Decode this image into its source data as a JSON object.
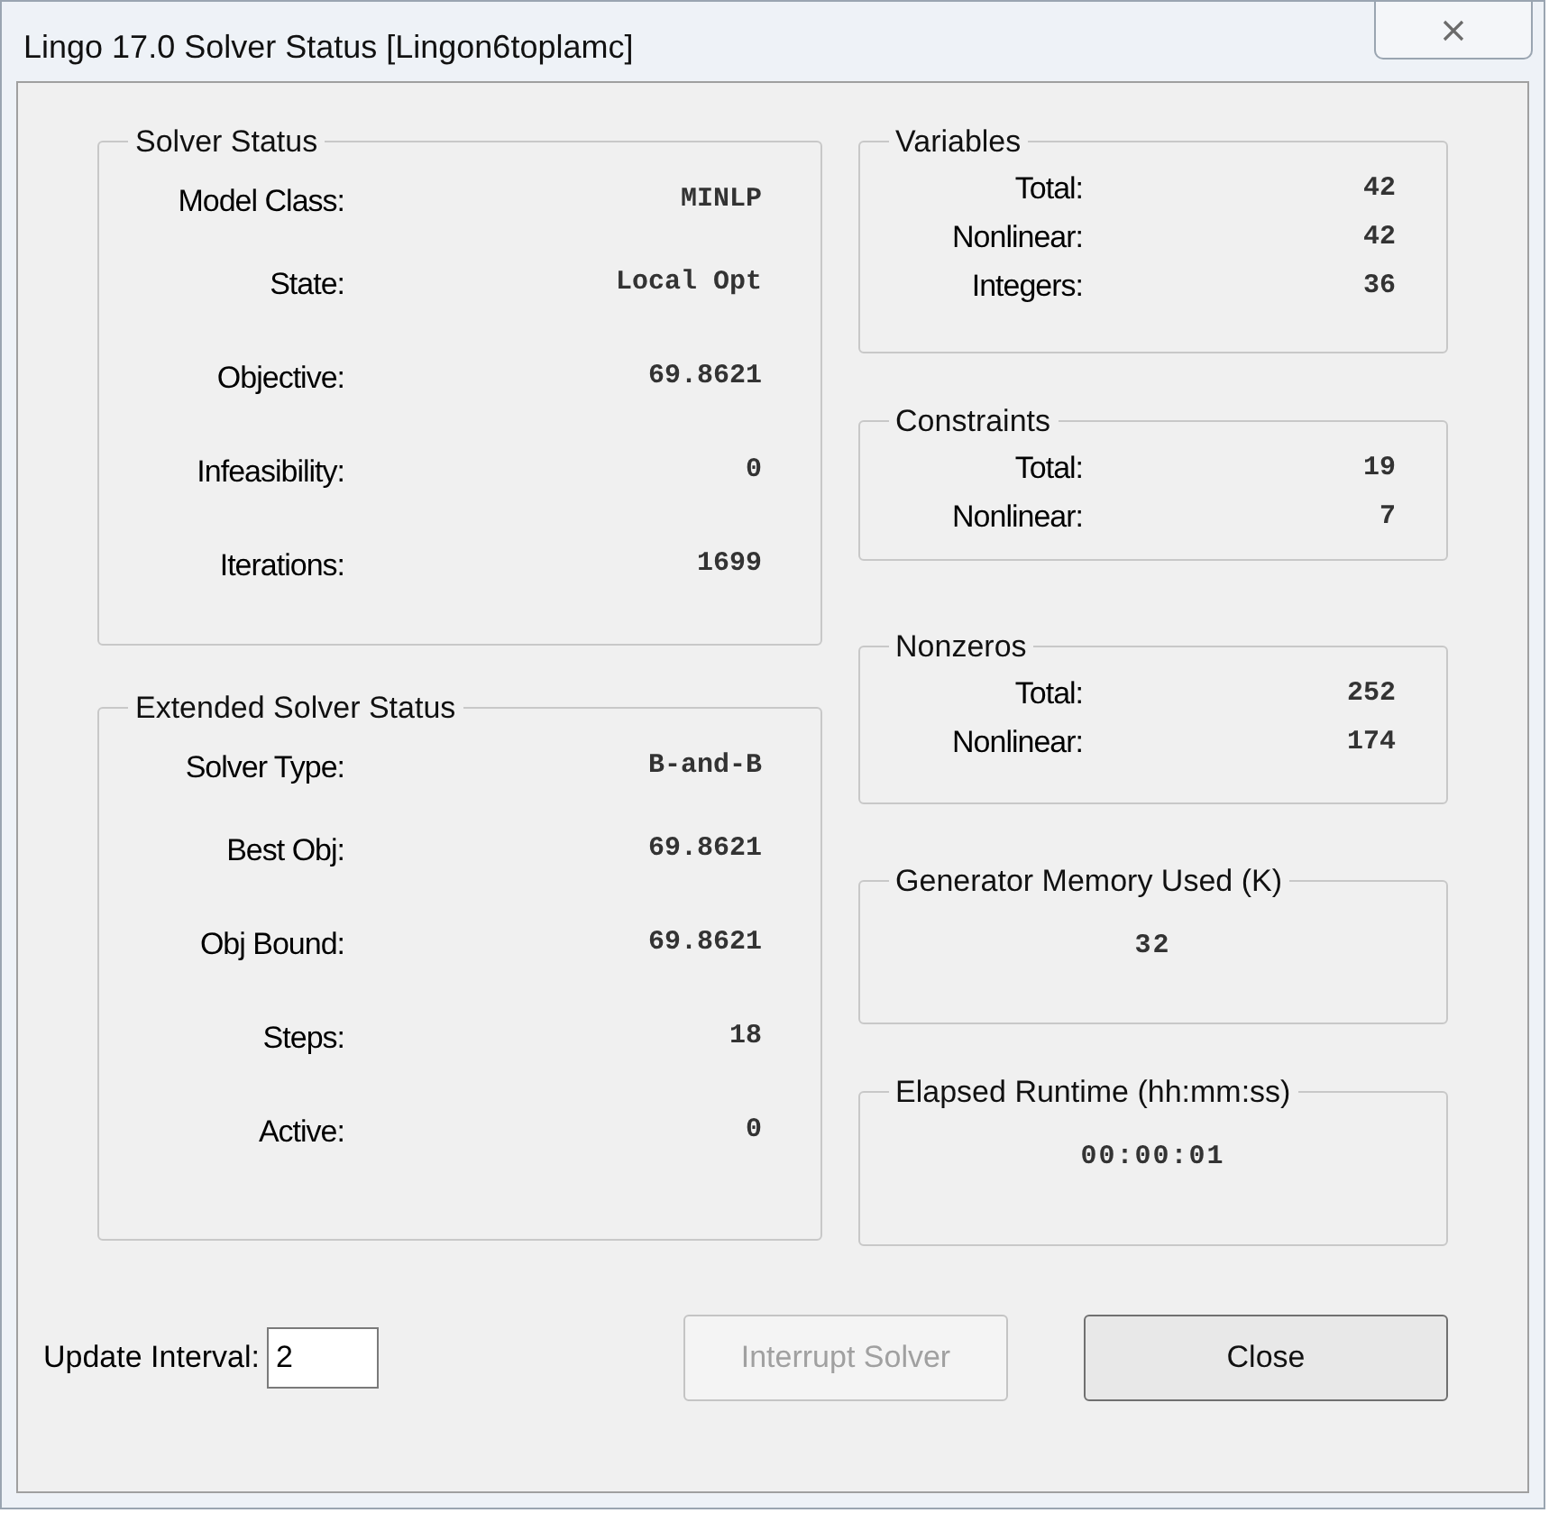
{
  "window": {
    "title": "Lingo 17.0 Solver Status [Lingon6toplamc]"
  },
  "left_groups": [
    {
      "title": "Solver Status",
      "rows": [
        {
          "label": "Model Class:",
          "value": "MINLP"
        },
        {
          "label": "State:",
          "value": "Local Opt"
        },
        {
          "label": "Objective:",
          "value": "69.8621"
        },
        {
          "label": "Infeasibility:",
          "value": "0"
        },
        {
          "label": "Iterations:",
          "value": "1699"
        }
      ]
    },
    {
      "title": "Extended Solver Status",
      "rows": [
        {
          "label": "Solver Type:",
          "value": "B-and-B"
        },
        {
          "label": "Best Obj:",
          "value": "69.8621"
        },
        {
          "label": "Obj Bound:",
          "value": "69.8621"
        },
        {
          "label": "Steps:",
          "value": "18"
        },
        {
          "label": "Active:",
          "value": "0"
        }
      ]
    }
  ],
  "right_groups": [
    {
      "kind": "rows",
      "title": "Variables",
      "rows": [
        {
          "label": "Total:",
          "value": "42"
        },
        {
          "label": "Nonlinear:",
          "value": "42"
        },
        {
          "label": "Integers:",
          "value": "36"
        }
      ]
    },
    {
      "kind": "rows",
      "title": "Constraints",
      "rows": [
        {
          "label": "Total:",
          "value": "19"
        },
        {
          "label": "Nonlinear:",
          "value": "7"
        }
      ]
    },
    {
      "kind": "rows",
      "title": "Nonzeros",
      "rows": [
        {
          "label": "Total:",
          "value": "252"
        },
        {
          "label": "Nonlinear:",
          "value": "174"
        }
      ]
    },
    {
      "kind": "single",
      "title": "Generator Memory Used (K)",
      "value": "32"
    },
    {
      "kind": "single",
      "title": "Elapsed Runtime (hh:mm:ss)",
      "value": "00:00:01"
    }
  ],
  "update_interval": {
    "label": "Update Interval:",
    "value": "2"
  },
  "buttons": [
    {
      "label": "Interrupt Solver",
      "disabled": true
    },
    {
      "label": "Close",
      "disabled": false
    }
  ]
}
